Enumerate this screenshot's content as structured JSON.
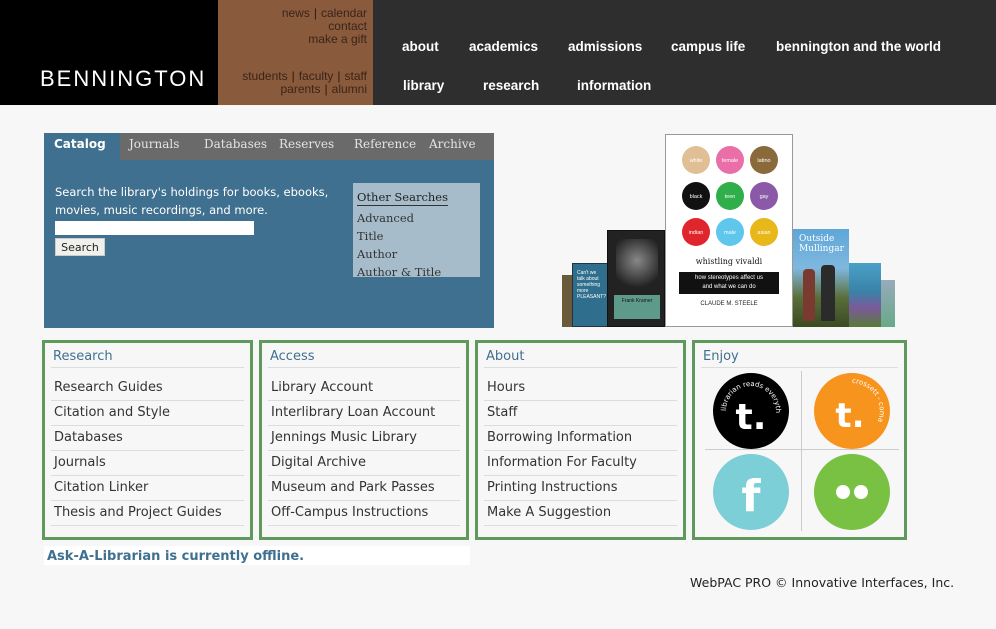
{
  "header": {
    "logo": "BENNINGTON",
    "utility_top": [
      "news",
      "calendar",
      "contact",
      "make a gift"
    ],
    "utility_bottom": [
      "students",
      "faculty",
      "staff",
      "parents",
      "alumni"
    ],
    "nav_row1": [
      "about",
      "academics",
      "admissions",
      "campus life",
      "bennington and the world"
    ],
    "nav_row2": [
      "library",
      "research",
      "information"
    ]
  },
  "catalog": {
    "tabs": [
      "Catalog",
      "Journals",
      "Databases",
      "Reserves",
      "Reference",
      "Archive"
    ],
    "description": "Search the library's holdings for books, ebooks, movies, music recordings, and more.",
    "search_value": "",
    "search_button": "Search",
    "other_searches_title": "Other Searches",
    "other_searches": [
      "Advanced",
      "Title",
      "Author",
      "Author & Title"
    ]
  },
  "books": {
    "featured": {
      "circles": [
        "white",
        "female",
        "latino",
        "black",
        "teen",
        "gay",
        "indian",
        "male",
        "asian"
      ],
      "title": "whistling vivaldi",
      "subtitle_line1": "how stereotypes affect us",
      "subtitle_line2": "and what we can do",
      "author": "CLAUDE M. STEELE"
    },
    "left_cover_text": "Can't we talk about something more PLEASANT?",
    "portrait_caption": "Frank Kramer",
    "right_cover_title": "Outside Mullingar"
  },
  "boxes": {
    "research": {
      "title": "Research",
      "items": [
        "Research Guides",
        "Citation and Style",
        "Databases",
        "Journals",
        "Citation Linker",
        "Thesis and Project Guides"
      ]
    },
    "access": {
      "title": "Access",
      "items": [
        "Library Account",
        "Interlibrary Loan Account",
        "Jennings Music Library",
        "Digital Archive",
        "Museum and Park Passes",
        "Off-Campus Instructions"
      ]
    },
    "about": {
      "title": "About",
      "items": [
        "Hours",
        "Staff",
        "Borrowing Information",
        "Information For Faculty",
        "Printing Instructions",
        "Make A Suggestion"
      ]
    },
    "enjoy": {
      "title": "Enjoy",
      "tumblr1_arc": "librarian reads everything",
      "tumblr2_arc": "crossett - coma"
    }
  },
  "colors": {
    "accent_blue": "#40708f",
    "box_green": "#5f9a5c",
    "header_dark": "#2e2e2e",
    "util_brown": "#8a5a3c",
    "tumblr_black": "#000000",
    "tumblr_orange": "#f7941d",
    "facebook_teal": "#7ccfd6",
    "flickr_green": "#79c142"
  },
  "status": {
    "ask": "Ask-A-Librarian is currently offline."
  },
  "footer": "WebPAC PRO © Innovative Interfaces, Inc."
}
